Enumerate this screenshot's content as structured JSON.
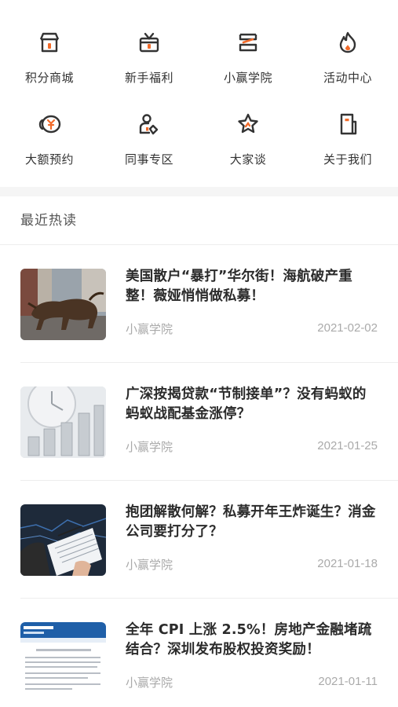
{
  "grid": [
    {
      "label": "积分商城",
      "icon": "shop-icon"
    },
    {
      "label": "新手福利",
      "icon": "gift-icon"
    },
    {
      "label": "小赢学院",
      "icon": "books-icon"
    },
    {
      "label": "活动中心",
      "icon": "flame-icon"
    },
    {
      "label": "大额预约",
      "icon": "yen-coins-icon"
    },
    {
      "label": "同事专区",
      "icon": "colleague-icon"
    },
    {
      "label": "大家谈",
      "icon": "star-icon"
    },
    {
      "label": "关于我们",
      "icon": "about-icon"
    }
  ],
  "section": {
    "title": "最近热读"
  },
  "articles": [
    {
      "title": "美国散户“暴打”华尔街！海航破产重整！薇娅悄悄做私募！",
      "source": "小赢学院",
      "date": "2021-02-02",
      "thumb": "bull-photo"
    },
    {
      "title": "广深按揭贷款“节制接单”？没有蚂蚁的蚂蚁战配基金涨停？",
      "source": "小赢学院",
      "date": "2021-01-25",
      "thumb": "clock-coins-photo"
    },
    {
      "title": "抱团解散何解？私募开年王炸诞生？消金公司要打分了？",
      "source": "小赢学院",
      "date": "2021-01-18",
      "thumb": "business-report-photo"
    },
    {
      "title": "全年 CPI 上涨 2.5%！房地产金融堵疏结合？深圳发布股权投资奖励！",
      "source": "小赢学院",
      "date": "2021-01-11",
      "thumb": "statistics-doc-photo"
    }
  ],
  "colors": {
    "accent": "#f26b2a",
    "icon_stroke": "#333333"
  }
}
